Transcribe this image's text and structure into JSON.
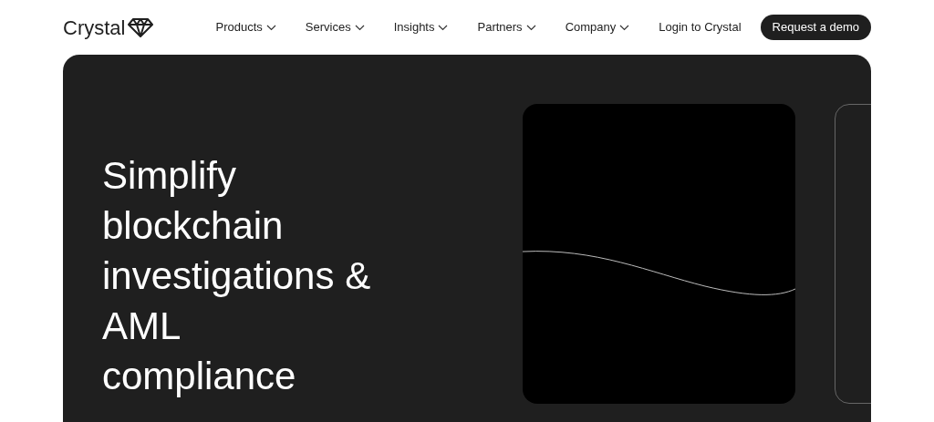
{
  "logo": {
    "text": "Crystal"
  },
  "nav": [
    {
      "label": "Products",
      "kind": "dropdown"
    },
    {
      "label": "Services",
      "kind": "dropdown"
    },
    {
      "label": "Insights",
      "kind": "dropdown"
    },
    {
      "label": "Partners",
      "kind": "dropdown"
    },
    {
      "label": "Company",
      "kind": "dropdown"
    },
    {
      "label": "Login to Crystal",
      "kind": "link"
    },
    {
      "label": "Request a demo",
      "kind": "button"
    }
  ],
  "hero": {
    "headline_lines": [
      "Simplify",
      "blockchain",
      "investigations &",
      "AML",
      "compliance"
    ]
  }
}
